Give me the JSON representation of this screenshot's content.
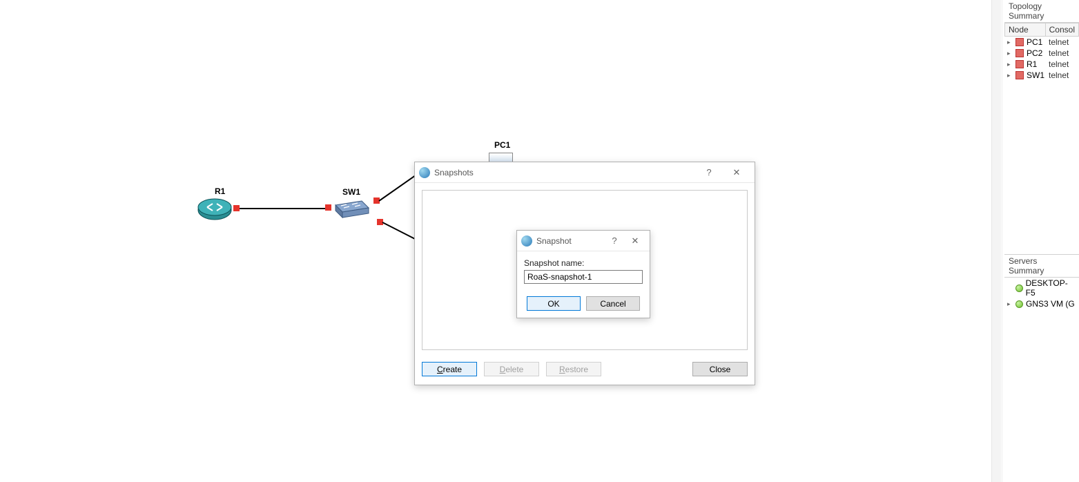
{
  "canvas": {
    "nodes": {
      "r1_label": "R1",
      "sw1_label": "SW1",
      "pc1_label": "PC1"
    }
  },
  "dialogs": {
    "snapshots": {
      "title": "Snapshots",
      "create": "Create",
      "delete": "Delete",
      "restore": "Restore",
      "close": "Close"
    },
    "snapshot": {
      "title": "Snapshot",
      "name_label": "Snapshot name:",
      "name_value": "RoaS-snapshot-1",
      "ok": "OK",
      "cancel": "Cancel"
    }
  },
  "topology": {
    "title": "Topology Summary",
    "col_node": "Node",
    "col_console": "Consol",
    "rows": [
      {
        "name": "PC1",
        "conn": "telnet"
      },
      {
        "name": "PC2",
        "conn": "telnet"
      },
      {
        "name": "R1",
        "conn": "telnet"
      },
      {
        "name": "SW1",
        "conn": "telnet"
      }
    ]
  },
  "servers": {
    "title": "Servers Summary",
    "rows": [
      {
        "name": "DESKTOP-F5"
      },
      {
        "name": "GNS3 VM (G"
      }
    ]
  }
}
